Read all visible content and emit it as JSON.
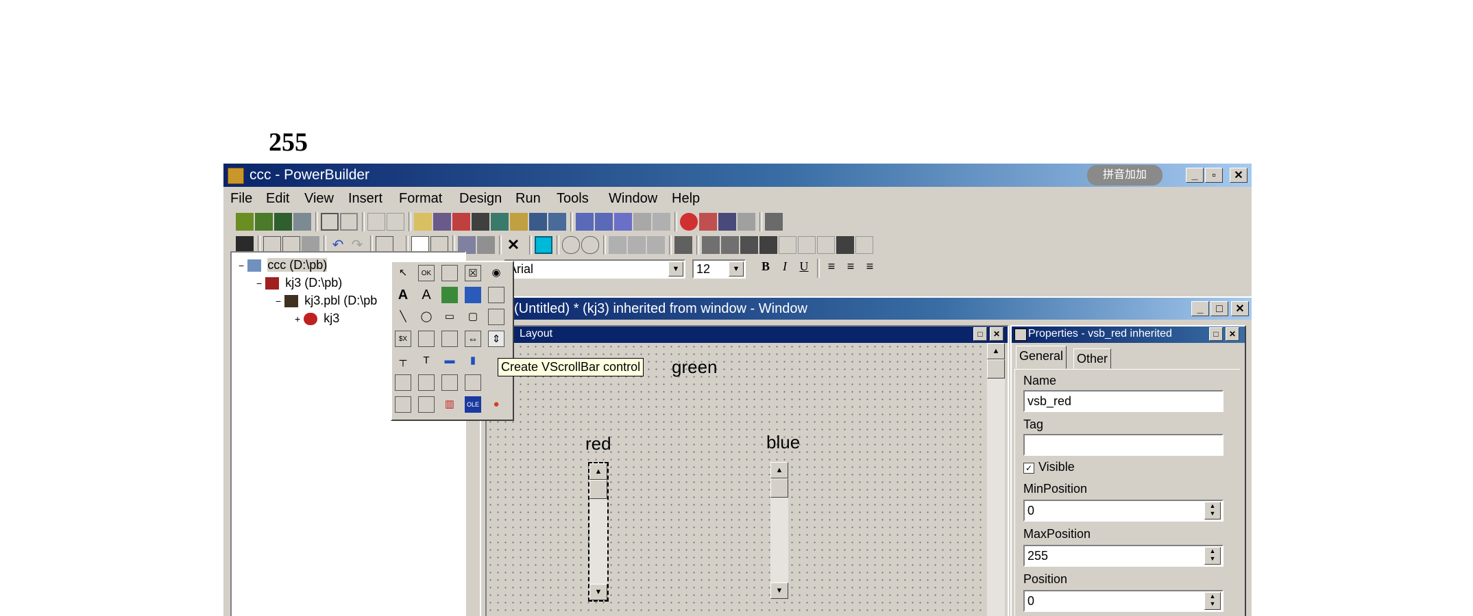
{
  "page_number": "255",
  "app": {
    "title": "ccc - PowerBuilder",
    "tray_text": "拼音加加",
    "minimize": "_",
    "restore": "▫",
    "close": "✕"
  },
  "menu": [
    "File",
    "Edit",
    "View",
    "Insert",
    "Format",
    "Design",
    "Run",
    "Tools",
    "Window",
    "Help"
  ],
  "format_bar": {
    "font_name": "Arial",
    "font_size": "12",
    "bold": "B",
    "italic": "I",
    "underline": "U"
  },
  "tree": [
    {
      "label": "ccc (D:\\pb)",
      "expander": "−"
    },
    {
      "label": "kj3 (D:\\pb)",
      "expander": "−"
    },
    {
      "label": "kj3.pbl (D:\\pb",
      "expander": "−"
    },
    {
      "label": "kj3",
      "expander": "+"
    }
  ],
  "tooltip": "Create VScrollBar control",
  "child_window": {
    "title": "(Untitled) * (kj3) inherited from window - Window",
    "layout_title": "Layout"
  },
  "canvas": {
    "green_label": "green",
    "red_label": "red",
    "blue_label": "blue"
  },
  "properties": {
    "title": "Properties - vsb_red inherited",
    "tabs": [
      "General",
      "Other"
    ],
    "name_label": "Name",
    "name_value": "vsb_red",
    "tag_label": "Tag",
    "tag_value": "",
    "visible_label": "Visible",
    "visible_checked": true,
    "min_label": "MinPosition",
    "min_value": "0",
    "max_label": "MaxPosition",
    "max_value": "255",
    "pos_label": "Position",
    "pos_value": "0"
  }
}
